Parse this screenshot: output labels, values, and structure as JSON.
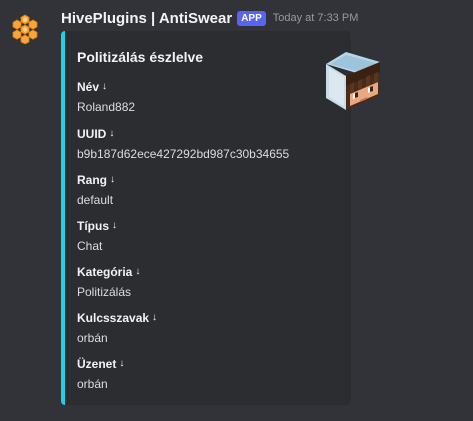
{
  "message": {
    "username": "HivePlugins | AntiSwear",
    "badge": "APP",
    "timestamp": "Today at 7:33 PM",
    "avatar_icon": "honeycomb-icon"
  },
  "embed": {
    "accent_color": "#1fd1e8",
    "title": "Politizálás észlelve",
    "thumbnail": "minecraft-skin-head",
    "arrow_glyph": "↓",
    "fields": [
      {
        "name": "Név",
        "value": "Roland882"
      },
      {
        "name": "UUID",
        "value": "b9b187d62ece427292bd987c30b34655"
      },
      {
        "name": "Rang",
        "value": "default"
      },
      {
        "name": "Típus",
        "value": "Chat"
      },
      {
        "name": "Kategória",
        "value": "Politizálás"
      },
      {
        "name": "Kulcsszavak",
        "value": "orbán"
      },
      {
        "name": "Üzenet",
        "value": "orbán"
      }
    ]
  }
}
